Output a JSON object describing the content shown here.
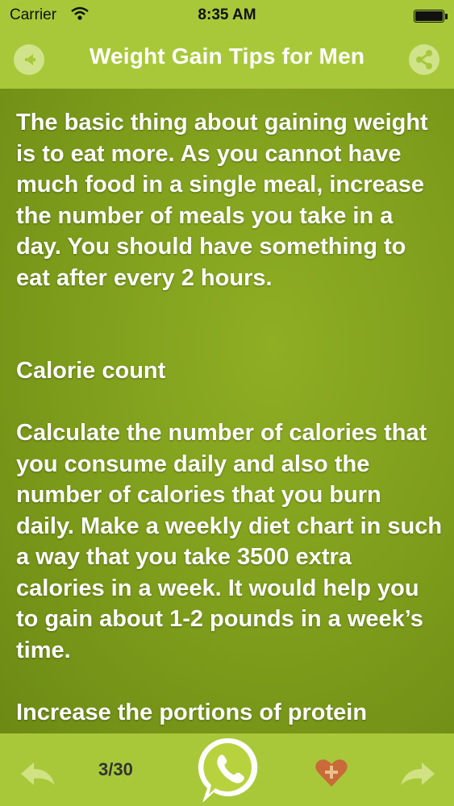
{
  "status": {
    "carrier": "Carrier",
    "time": "8:35 AM"
  },
  "header": {
    "title": "Weight Gain Tips for Men"
  },
  "article": {
    "p1": "The basic thing about gaining weight is to eat more. As you cannot have much food in a single meal, increase the number of meals you take in a day. You should have something to eat after every 2 hours.",
    "p2": "Calorie count",
    "p3": "Calculate the number of calories that you consume daily and also the number of calories that you burn daily. Make a weekly diet chart in such a way that you take 3500 extra calories in a week. It would help you to gain about 1-2 pounds in a week’s time.",
    "p4": "Increase the portions of protein"
  },
  "toolbar": {
    "counter": "3/30"
  },
  "icons": {
    "back": "back-arrow-icon",
    "share": "share-icon",
    "prev": "prev-arrow-icon",
    "call": "phone-icon",
    "favorite": "heart-plus-icon",
    "next": "next-arrow-icon"
  },
  "colors": {
    "bar": "#a8c83a",
    "background": "#7e9e1c",
    "text": "#ffffff"
  }
}
